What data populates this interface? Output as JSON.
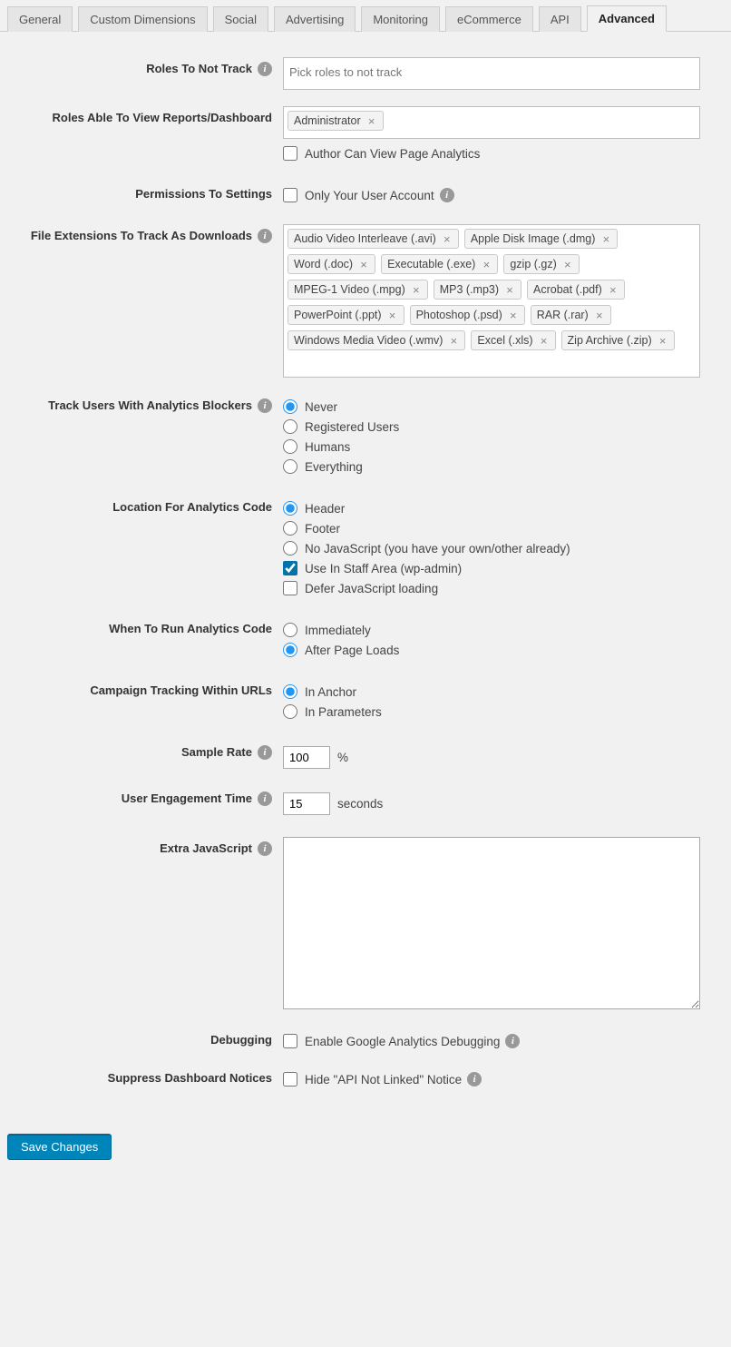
{
  "tabs": [
    "General",
    "Custom Dimensions",
    "Social",
    "Advertising",
    "Monitoring",
    "eCommerce",
    "API",
    "Advanced"
  ],
  "active_tab": "Advanced",
  "labels": {
    "roles_not_track": "Roles To Not Track",
    "roles_view": "Roles Able To View Reports/Dashboard",
    "author_view": "Author Can View Page Analytics",
    "perm_settings": "Permissions To Settings",
    "only_your_account": "Only Your User Account",
    "file_ext": "File Extensions To Track As Downloads",
    "track_blockers": "Track Users With Analytics Blockers",
    "location_code": "Location For Analytics Code",
    "when_run": "When To Run Analytics Code",
    "campaign": "Campaign Tracking Within URLs",
    "sample_rate": "Sample Rate",
    "engagement": "User Engagement Time",
    "extra_js": "Extra JavaScript",
    "debugging": "Debugging",
    "suppress": "Suppress Dashboard Notices",
    "debug_opt": "Enable Google Analytics Debugging",
    "suppress_opt": "Hide \"API Not Linked\" Notice",
    "percent": "%",
    "seconds": "seconds"
  },
  "placeholders": {
    "roles_not_track": "Pick roles to not track"
  },
  "roles_view_tags": [
    "Administrator"
  ],
  "file_ext_tags": [
    "Audio Video Interleave (.avi)",
    "Apple Disk Image (.dmg)",
    "Word (.doc)",
    "Executable (.exe)",
    "gzip (.gz)",
    "MPEG-1 Video (.mpg)",
    "MP3 (.mp3)",
    "Acrobat (.pdf)",
    "PowerPoint (.ppt)",
    "Photoshop (.psd)",
    "RAR (.rar)",
    "Windows Media Video (.wmv)",
    "Excel (.xls)",
    "Zip Archive (.zip)"
  ],
  "blockers_options": [
    "Never",
    "Registered Users",
    "Humans",
    "Everything"
  ],
  "blockers_selected": "Never",
  "location_radios": [
    "Header",
    "Footer",
    "No JavaScript (you have your own/other already)"
  ],
  "location_selected": "Header",
  "location_checks": [
    {
      "label": "Use In Staff Area (wp-admin)",
      "checked": true
    },
    {
      "label": "Defer JavaScript loading",
      "checked": false
    }
  ],
  "when_run_options": [
    "Immediately",
    "After Page Loads"
  ],
  "when_run_selected": "After Page Loads",
  "campaign_options": [
    "In Anchor",
    "In Parameters"
  ],
  "campaign_selected": "In Anchor",
  "sample_rate": "100",
  "engagement_time": "15",
  "save_button": "Save Changes"
}
